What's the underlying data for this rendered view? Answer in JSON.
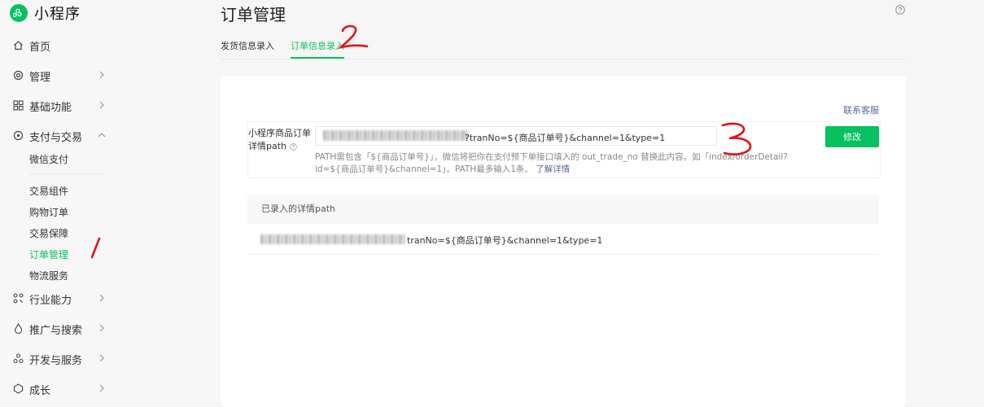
{
  "app": {
    "name": "小程序"
  },
  "sidebar": {
    "items": [
      {
        "label": "首页",
        "icon": "home-icon"
      },
      {
        "label": "管理",
        "icon": "manage-icon"
      },
      {
        "label": "基础功能",
        "icon": "grid-icon"
      },
      {
        "label": "支付与交易",
        "icon": "pay-icon"
      },
      {
        "label": "行业能力",
        "icon": "industry-icon"
      },
      {
        "label": "推广与搜索",
        "icon": "promote-icon"
      },
      {
        "label": "开发与服务",
        "icon": "dev-icon"
      },
      {
        "label": "成长",
        "icon": "growth-icon"
      }
    ],
    "sub_items": {
      "pay_top": "微信支付",
      "trade": [
        "交易组件",
        "购物订单",
        "交易保障",
        "订单管理",
        "物流服务"
      ]
    }
  },
  "page": {
    "title": "订单管理"
  },
  "tabs": [
    {
      "label": "发货信息录入"
    },
    {
      "label": "订单信息录入",
      "active": true
    }
  ],
  "card": {
    "service_link": "联系客服",
    "form": {
      "label": "小程序商品订单详情path",
      "input_visible_tail": "?tranNo=${商品订单号}&channel=1&type=1",
      "hint": "PATH需包含「${商品订单号}」，微信将把你在支付预下单接口填入的 out_trade_no 替换此内容。如「index/orderDetail?id=${商品订单号}&channel=1」。PATH最多输入1条。",
      "hint_link": "了解详情",
      "button": "修改"
    },
    "list": {
      "header": "已录入的详情path",
      "rows": [
        {
          "visible_tail": "tranNo=${商品订单号}&channel=1&type=1"
        }
      ]
    }
  },
  "annotations": [
    "1",
    "2",
    "3"
  ],
  "colors": {
    "accent": "#07c160",
    "link": "#576b95",
    "annotation": "#e0121c"
  }
}
